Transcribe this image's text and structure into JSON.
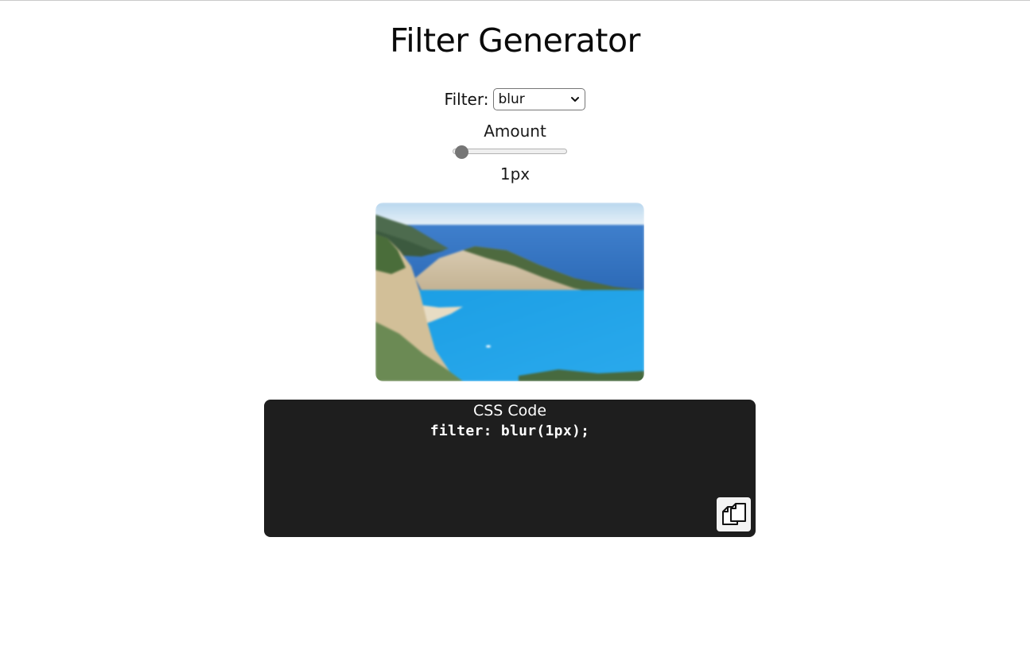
{
  "page": {
    "title": "Filter Generator"
  },
  "controls": {
    "filter_label": "Filter:",
    "filter_selected": "blur",
    "amount_label": "Amount",
    "amount_value": 1,
    "amount_display": "1px"
  },
  "preview": {
    "icon": "landscape-photo"
  },
  "code": {
    "title": "CSS Code",
    "line": "filter: blur(1px);",
    "copy_icon": "copy-icon"
  },
  "colors": {
    "code_bg": "#1e1e1e",
    "thumb": "#767676"
  }
}
